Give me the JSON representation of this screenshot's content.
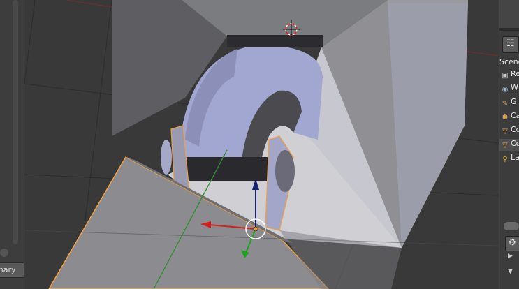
{
  "toolshelf": {
    "tab_label": "mary"
  },
  "outliner": {
    "header": "Scene",
    "items": [
      {
        "label": "Re",
        "icon": "render-layers-icon",
        "color": "#c8c8c8"
      },
      {
        "label": "W",
        "icon": "world-icon",
        "color": "#a8b7d0"
      },
      {
        "label": "G",
        "icon": "grease-pencil-icon",
        "color": "#e0a050"
      },
      {
        "label": "Ca",
        "icon": "camera-icon",
        "color": "#e8a040"
      },
      {
        "label": "Co",
        "icon": "mesh-cone-icon",
        "color": "#f0a030"
      },
      {
        "label": "Co",
        "icon": "mesh-cone-icon",
        "color": "#f0a030"
      },
      {
        "label": "La",
        "icon": "lamp-icon",
        "color": "#f0c040"
      }
    ],
    "selected_index": 5
  },
  "viewport": {
    "background": "#393939",
    "selection_color": "#f0a040",
    "axis_x_color": "#cc2020",
    "axis_y_color": "#20a020",
    "axis_z_color": "#1a2fa0"
  }
}
